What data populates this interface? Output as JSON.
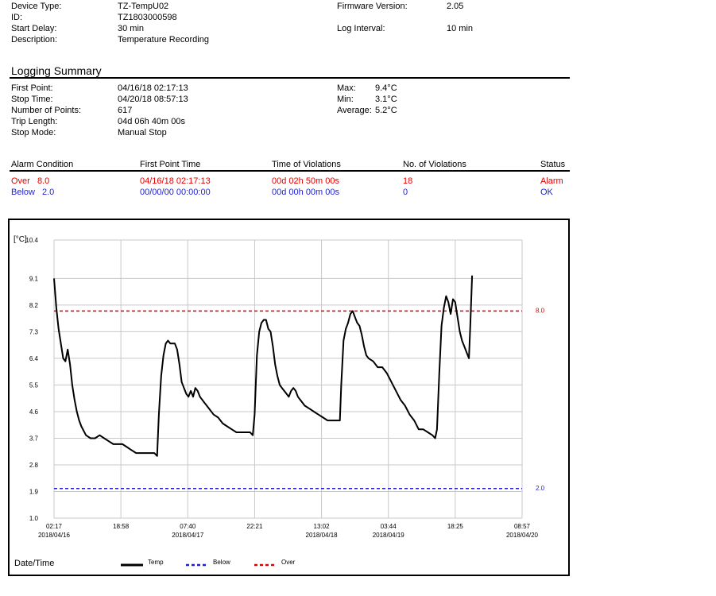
{
  "device": {
    "device_type_label": "Device Type:",
    "device_type": "TZ-TempU02",
    "id_label": "ID:",
    "id": "TZ1803000598",
    "start_delay_label": "Start Delay:",
    "start_delay": "30 min",
    "description_label": "Description:",
    "description": "Temperature Recording",
    "firmware_label": "Firmware Version:",
    "firmware": "2.05",
    "log_interval_label": "Log Interval:",
    "log_interval": "10 min"
  },
  "summary": {
    "title": "Logging Summary",
    "first_point_label": "First Point:",
    "first_point": "04/16/18 02:17:13",
    "stop_time_label": "Stop Time:",
    "stop_time": "04/20/18 08:57:13",
    "num_points_label": "Number of Points:",
    "num_points": "617",
    "trip_length_label": "Trip Length:",
    "trip_length": "04d 06h 40m 00s",
    "stop_mode_label": "Stop Mode:",
    "stop_mode": "Manual Stop",
    "max_label": "Max:",
    "max": "9.4°C",
    "min_label": "Min:",
    "min": "3.1°C",
    "avg_label": "Average:",
    "avg": "5.2°C"
  },
  "alarms": {
    "headers": [
      "Alarm Condition",
      "First Point Time",
      "Time of Violations",
      "No. of Violations",
      "Status"
    ],
    "rows": [
      {
        "cond_label": "Over",
        "cond_value": "8.0",
        "first_point_time": "04/16/18 02:17:13",
        "time_violations": "00d 02h 50m 00s",
        "count": "18",
        "status": "Alarm",
        "color": "#e00000"
      },
      {
        "cond_label": "Below",
        "cond_value": "2.0",
        "first_point_time": "00/00/00 00:00:00",
        "time_violations": "00d 00h 00m 00s",
        "count": "0",
        "status": "OK",
        "color": "#1f1fd0"
      }
    ]
  },
  "chart_data": {
    "type": "line",
    "ylabel": "[°C]",
    "xlabel": "Date/Time",
    "ylim": [
      1.0,
      10.4
    ],
    "yticks": [
      "10.4",
      "9.1",
      "8.2",
      "7.3",
      "6.4",
      "5.5",
      "4.6",
      "3.7",
      "2.8",
      "1.9",
      "1.0"
    ],
    "xticks": [
      {
        "time": "02:17",
        "date": "2018/04/16"
      },
      {
        "time": "18:58",
        "date": ""
      },
      {
        "time": "07:40",
        "date": "2018/04/17"
      },
      {
        "time": "22:21",
        "date": ""
      },
      {
        "time": "13:02",
        "date": "2018/04/18"
      },
      {
        "time": "03:44",
        "date": "2018/04/19"
      },
      {
        "time": "18:25",
        "date": ""
      },
      {
        "time": "08:57",
        "date": "2018/04/20"
      }
    ],
    "x_range_hours": [
      0,
      102.67
    ],
    "thresholds": [
      {
        "name": "Over",
        "value": 8.0,
        "label": "8.0",
        "color": "#e00000"
      },
      {
        "name": "Below",
        "value": 2.0,
        "label": "2.0",
        "color": "#1f1fd0"
      }
    ],
    "legend": [
      {
        "name": "Temp",
        "style": "solid",
        "color": "#000000"
      },
      {
        "name": "Below",
        "style": "dashed",
        "color": "#1f1fd0"
      },
      {
        "name": "Over",
        "style": "dashed",
        "color": "#e00000"
      }
    ],
    "series": [
      {
        "name": "Temp",
        "color": "#000000",
        "points": [
          [
            0.0,
            9.1
          ],
          [
            0.5,
            8.1
          ],
          [
            1.0,
            7.4
          ],
          [
            1.5,
            6.9
          ],
          [
            2.0,
            6.4
          ],
          [
            2.5,
            6.3
          ],
          [
            3.0,
            6.7
          ],
          [
            3.5,
            6.2
          ],
          [
            4.0,
            5.5
          ],
          [
            4.5,
            5.0
          ],
          [
            5.0,
            4.6
          ],
          [
            5.5,
            4.3
          ],
          [
            6.0,
            4.1
          ],
          [
            7.0,
            3.8
          ],
          [
            8.0,
            3.7
          ],
          [
            9.0,
            3.7
          ],
          [
            10.0,
            3.8
          ],
          [
            11.0,
            3.7
          ],
          [
            12.0,
            3.6
          ],
          [
            13.0,
            3.5
          ],
          [
            14.0,
            3.5
          ],
          [
            15.0,
            3.5
          ],
          [
            16.0,
            3.4
          ],
          [
            17.0,
            3.3
          ],
          [
            18.0,
            3.2
          ],
          [
            19.0,
            3.2
          ],
          [
            20.0,
            3.2
          ],
          [
            21.0,
            3.2
          ],
          [
            22.0,
            3.2
          ],
          [
            22.6,
            3.1
          ],
          [
            23.0,
            4.5
          ],
          [
            23.5,
            5.8
          ],
          [
            24.0,
            6.5
          ],
          [
            24.5,
            6.9
          ],
          [
            25.0,
            7.0
          ],
          [
            25.5,
            6.9
          ],
          [
            26.0,
            6.9
          ],
          [
            26.5,
            6.9
          ],
          [
            27.0,
            6.7
          ],
          [
            27.5,
            6.2
          ],
          [
            28.0,
            5.6
          ],
          [
            28.5,
            5.4
          ],
          [
            29.0,
            5.2
          ],
          [
            29.5,
            5.1
          ],
          [
            30.0,
            5.3
          ],
          [
            30.5,
            5.1
          ],
          [
            31.0,
            5.4
          ],
          [
            31.5,
            5.3
          ],
          [
            32.0,
            5.1
          ],
          [
            33.0,
            4.9
          ],
          [
            34.0,
            4.7
          ],
          [
            35.0,
            4.5
          ],
          [
            36.0,
            4.4
          ],
          [
            37.0,
            4.2
          ],
          [
            38.0,
            4.1
          ],
          [
            39.0,
            4.0
          ],
          [
            40.0,
            3.9
          ],
          [
            41.0,
            3.9
          ],
          [
            42.0,
            3.9
          ],
          [
            43.0,
            3.9
          ],
          [
            43.6,
            3.8
          ],
          [
            44.0,
            4.5
          ],
          [
            44.5,
            6.5
          ],
          [
            45.0,
            7.3
          ],
          [
            45.5,
            7.6
          ],
          [
            46.0,
            7.7
          ],
          [
            46.5,
            7.7
          ],
          [
            47.0,
            7.4
          ],
          [
            47.5,
            7.3
          ],
          [
            48.0,
            6.8
          ],
          [
            48.5,
            6.2
          ],
          [
            49.0,
            5.8
          ],
          [
            49.5,
            5.5
          ],
          [
            50.0,
            5.4
          ],
          [
            50.5,
            5.3
          ],
          [
            51.0,
            5.2
          ],
          [
            51.5,
            5.1
          ],
          [
            52.0,
            5.3
          ],
          [
            52.5,
            5.4
          ],
          [
            53.0,
            5.3
          ],
          [
            53.5,
            5.1
          ],
          [
            54.0,
            5.0
          ],
          [
            55.0,
            4.8
          ],
          [
            56.0,
            4.7
          ],
          [
            57.0,
            4.6
          ],
          [
            58.0,
            4.5
          ],
          [
            59.0,
            4.4
          ],
          [
            60.0,
            4.3
          ],
          [
            61.0,
            4.3
          ],
          [
            62.0,
            4.3
          ],
          [
            62.7,
            4.3
          ],
          [
            63.0,
            5.5
          ],
          [
            63.5,
            7.0
          ],
          [
            64.0,
            7.4
          ],
          [
            64.5,
            7.6
          ],
          [
            65.0,
            7.9
          ],
          [
            65.5,
            8.0
          ],
          [
            66.0,
            7.8
          ],
          [
            66.5,
            7.6
          ],
          [
            67.0,
            7.5
          ],
          [
            67.5,
            7.2
          ],
          [
            68.0,
            6.8
          ],
          [
            68.5,
            6.5
          ],
          [
            69.0,
            6.4
          ],
          [
            70.0,
            6.3
          ],
          [
            71.0,
            6.1
          ],
          [
            72.0,
            6.1
          ],
          [
            73.0,
            5.9
          ],
          [
            74.0,
            5.6
          ],
          [
            75.0,
            5.3
          ],
          [
            76.0,
            5.0
          ],
          [
            77.0,
            4.8
          ],
          [
            78.0,
            4.5
          ],
          [
            79.0,
            4.3
          ],
          [
            80.0,
            4.0
          ],
          [
            81.0,
            4.0
          ],
          [
            82.0,
            3.9
          ],
          [
            83.0,
            3.8
          ],
          [
            83.6,
            3.7
          ],
          [
            84.0,
            4.0
          ],
          [
            84.5,
            5.9
          ],
          [
            85.0,
            7.5
          ],
          [
            85.5,
            8.1
          ],
          [
            86.0,
            8.5
          ],
          [
            86.5,
            8.3
          ],
          [
            87.0,
            7.9
          ],
          [
            87.5,
            8.4
          ],
          [
            88.0,
            8.3
          ],
          [
            88.5,
            7.8
          ],
          [
            89.0,
            7.3
          ],
          [
            89.5,
            7.0
          ],
          [
            90.0,
            6.8
          ],
          [
            90.5,
            6.6
          ],
          [
            91.0,
            6.4
          ],
          [
            91.3,
            7.5
          ],
          [
            91.7,
            9.2
          ]
        ]
      }
    ]
  }
}
